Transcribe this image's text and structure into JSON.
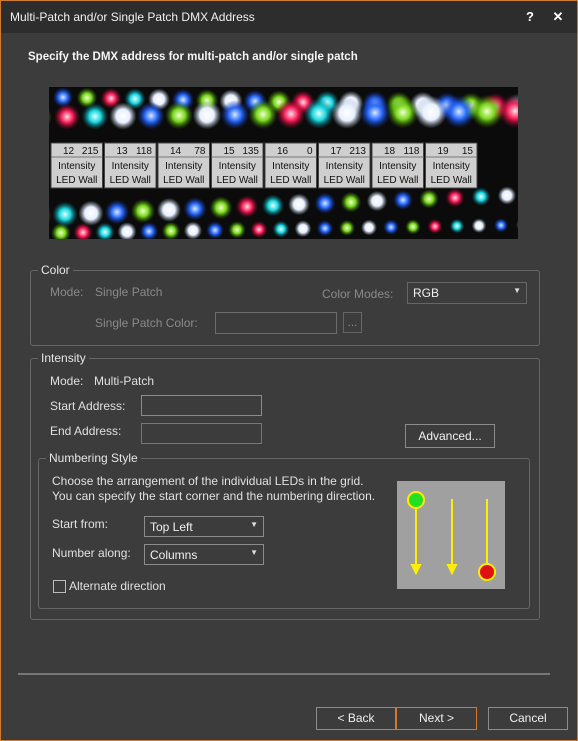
{
  "window": {
    "title": "Multi-Patch and/or Single Patch DMX Address",
    "help": "?",
    "close": "✕"
  },
  "heading": "Specify the DMX address for multi-patch and/or single patch",
  "preview": {
    "cells": [
      {
        "num": "12",
        "addr": "215",
        "attr": "Intensity",
        "fixture": "LED Wall"
      },
      {
        "num": "13",
        "addr": "118",
        "attr": "Intensity",
        "fixture": "LED Wall"
      },
      {
        "num": "14",
        "addr": "78",
        "attr": "Intensity",
        "fixture": "LED Wall"
      },
      {
        "num": "15",
        "addr": "135",
        "attr": "Intensity",
        "fixture": "LED Wall"
      },
      {
        "num": "16",
        "addr": "0",
        "attr": "Intensity",
        "fixture": "LED Wall"
      },
      {
        "num": "17",
        "addr": "213",
        "attr": "Intensity",
        "fixture": "LED Wall"
      },
      {
        "num": "18",
        "addr": "118",
        "attr": "Intensity",
        "fixture": "LED Wall"
      },
      {
        "num": "19",
        "addr": "15",
        "attr": "Intensity",
        "fixture": "LED Wall"
      }
    ]
  },
  "color_group": {
    "label": "Color",
    "mode_label": "Mode:",
    "mode_value": "Single Patch",
    "color_modes_label": "Color Modes:",
    "color_modes_value": "RGB",
    "single_patch_color_label": "Single Patch Color:",
    "browse": "..."
  },
  "intensity_group": {
    "label": "Intensity",
    "mode_label": "Mode:",
    "mode_value": "Multi-Patch",
    "start_label": "Start Address:",
    "end_label": "End Address:",
    "advanced": "Advanced..."
  },
  "numbering": {
    "label": "Numbering Style",
    "desc": "Choose the arrangement of the individual LEDs in the grid. You can specify the start corner and the numbering direction.",
    "start_from_label": "Start from:",
    "start_from_value": "Top Left",
    "number_along_label": "Number along:",
    "number_along_value": "Columns",
    "alternate_label": "Alternate direction"
  },
  "footer": {
    "back": "< Back",
    "next": "Next >",
    "cancel": "Cancel"
  }
}
